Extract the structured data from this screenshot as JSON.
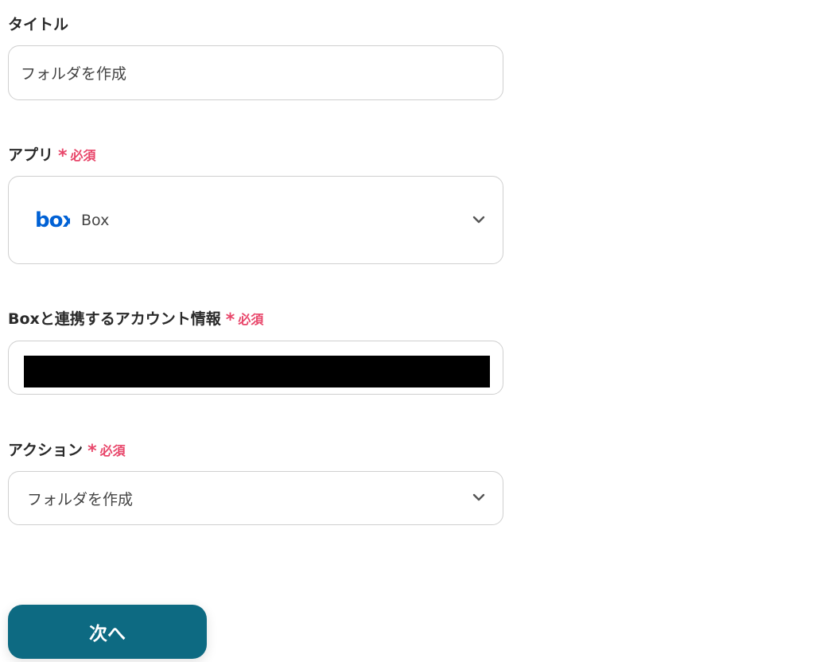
{
  "form": {
    "title": {
      "label": "タイトル",
      "value": "フォルダを作成"
    },
    "app": {
      "label": "アプリ",
      "required_mark": "*",
      "required_text": "必須",
      "value": "Box",
      "logo_text": "box",
      "logo_color": "#0061d5"
    },
    "account": {
      "label": "Boxと連携するアカウント情報",
      "required_mark": "*",
      "required_text": "必須"
    },
    "action": {
      "label": "アクション",
      "required_mark": "*",
      "required_text": "必須",
      "value": "フォルダを作成"
    }
  },
  "footer": {
    "next_label": "次へ",
    "next_color": "#0d6a82"
  },
  "icons": {
    "dropdown": "chevron-down-icon",
    "brand": "box-logo-icon"
  }
}
